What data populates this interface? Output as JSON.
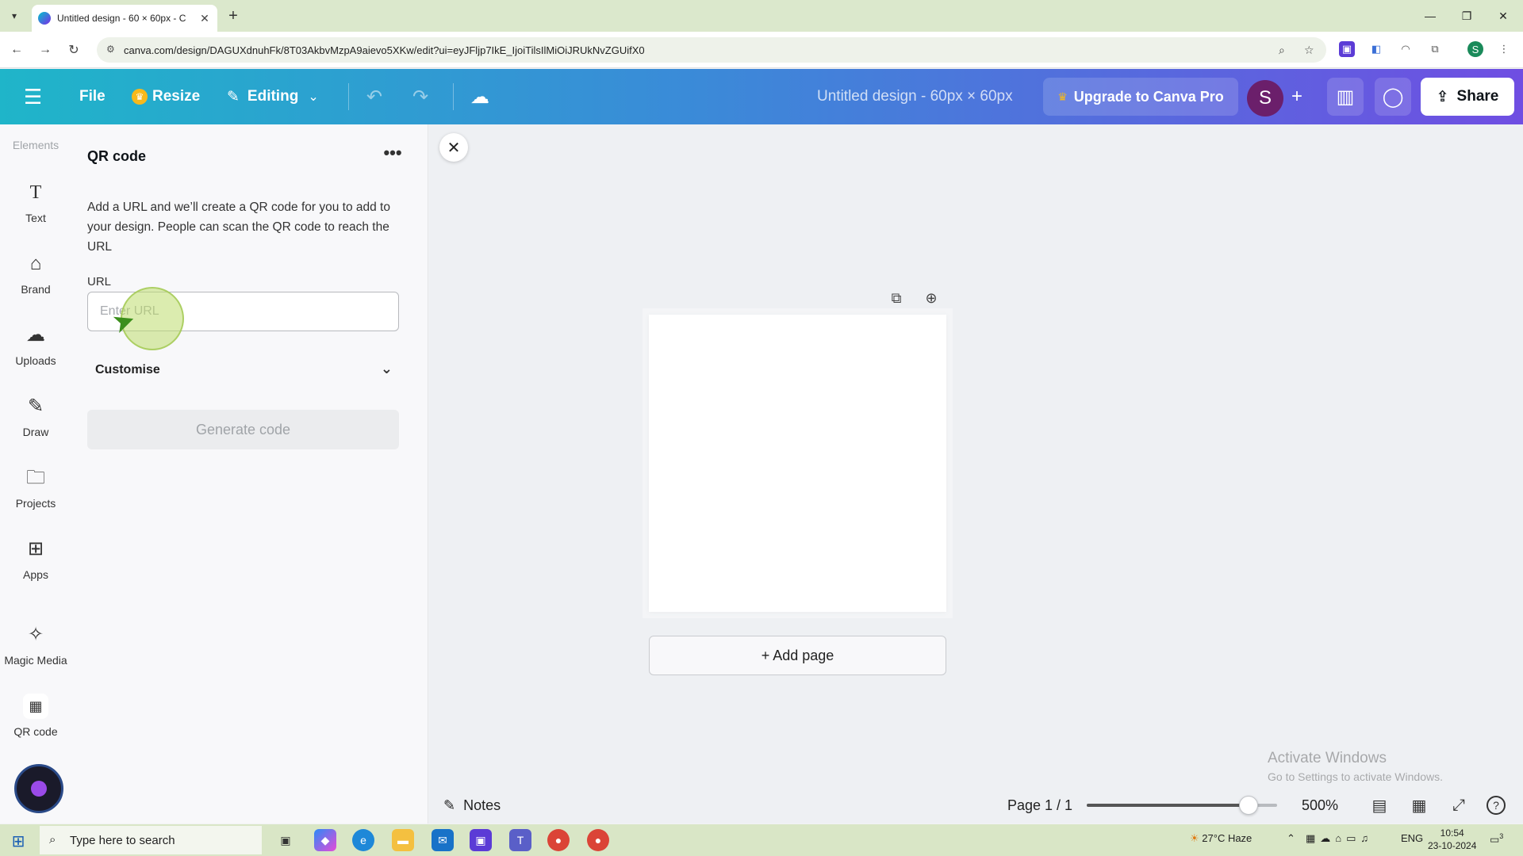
{
  "browser": {
    "tab_title": "Untitled design - 60 × 60px - C",
    "url": "canva.com/design/DAGUXdnuhFk/8T03AkbvMzpA9aievo5XKw/edit?ui=eyJFljp7IkE_IjoiTilsIlMiOiJRUkNvZGUifX0"
  },
  "header": {
    "file_label": "File",
    "resize_label": "Resize",
    "editing_label": "Editing",
    "design_title": "Untitled design - 60px × 60px",
    "upgrade_label": "Upgrade to Canva Pro",
    "avatar_initial": "S",
    "share_label": "Share",
    "brand_gradient": [
      "#1fb5c9",
      "#3a8bd8",
      "#6f4ee2"
    ]
  },
  "rail": {
    "top_label": "Elements",
    "items": [
      {
        "label": "Text",
        "icon": "text-icon"
      },
      {
        "label": "Brand",
        "icon": "brand-icon"
      },
      {
        "label": "Uploads",
        "icon": "upload-cloud-icon"
      },
      {
        "label": "Draw",
        "icon": "pen-icon"
      },
      {
        "label": "Projects",
        "icon": "folder-icon"
      },
      {
        "label": "Apps",
        "icon": "apps-grid-icon"
      },
      {
        "label": "Magic Media",
        "icon": "magic-media-icon"
      },
      {
        "label": "QR code",
        "icon": "qr-code-icon"
      }
    ]
  },
  "panel": {
    "title": "QR code",
    "description": "Add a URL and we’ll create a QR code for you to add to your design. People can scan the QR code to reach the URL",
    "url_label": "URL",
    "url_placeholder": "Enter URL",
    "url_value": "",
    "customise_label": "Customise",
    "generate_label": "Generate code"
  },
  "canvas": {
    "add_page_label": "+ Add page",
    "watermark_title": "Activate Windows",
    "watermark_sub": "Go to Settings to activate Windows."
  },
  "bottombar": {
    "notes_label": "Notes",
    "page_indicator": "Page 1 / 1",
    "zoom_label": "500%",
    "zoom_fraction": 0.85
  },
  "taskbar": {
    "search_placeholder": "Type here to search",
    "weather": "27°C  Haze",
    "language": "ENG",
    "time": "10:54",
    "date": "23-10-2024",
    "notification_count": "3"
  }
}
